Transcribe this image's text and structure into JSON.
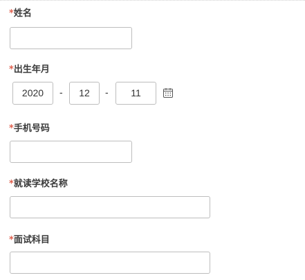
{
  "form": {
    "required_mark": "*",
    "name": {
      "label": "姓名",
      "value": ""
    },
    "birth_date": {
      "label": "出生年月",
      "year": "2020",
      "month": "12",
      "day": "11",
      "separator": "-",
      "icon": "calendar-icon"
    },
    "phone": {
      "label": "手机号码",
      "value": ""
    },
    "school": {
      "label": "就读学校名称",
      "value": ""
    },
    "subject": {
      "label": "面试科目",
      "value": ""
    }
  },
  "colors": {
    "required": "#e0614f",
    "label": "#3a3a3a",
    "border": "#bdbdbd"
  }
}
